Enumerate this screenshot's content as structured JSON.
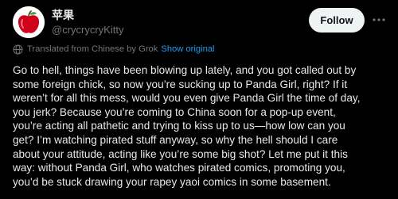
{
  "author": {
    "display_name": "苹果",
    "handle": "@crycrycryKitty",
    "avatar_icon": "red-apple-icon"
  },
  "actions": {
    "follow_label": "Follow",
    "more_icon": "more-dots-icon"
  },
  "translation": {
    "icon": "globe-icon",
    "note": "Translated from Chinese by Grok",
    "show_original_label": "Show original"
  },
  "post": {
    "lines": [
      "Go to hell, things have been blowing up lately, and you got called out by",
      "some foreign chick, so now you’re sucking up to Panda Girl, right? If it",
      "weren’t for all this mess, would you even give Panda Girl the time of day,",
      "you jerk? Because you’re coming to China soon for a pop-up event,",
      "you’re acting all pathetic and trying to kiss up to us—how low can you",
      "get? I’m watching pirated stuff anyway, so why the hell should I care",
      "about your attitude, acting like you’re some big shot? Let me put it this",
      "way: without Panda Girl, who watches pirated comics, promoting you,",
      "you’d be stuck drawing your rapey yaoi comics in some basement."
    ]
  },
  "colors": {
    "background": "#000000",
    "text_primary": "#e7e9ea",
    "text_secondary": "#71767b",
    "link": "#1d9bf0",
    "follow_bg": "#eff3f4",
    "follow_text": "#0f1419"
  }
}
